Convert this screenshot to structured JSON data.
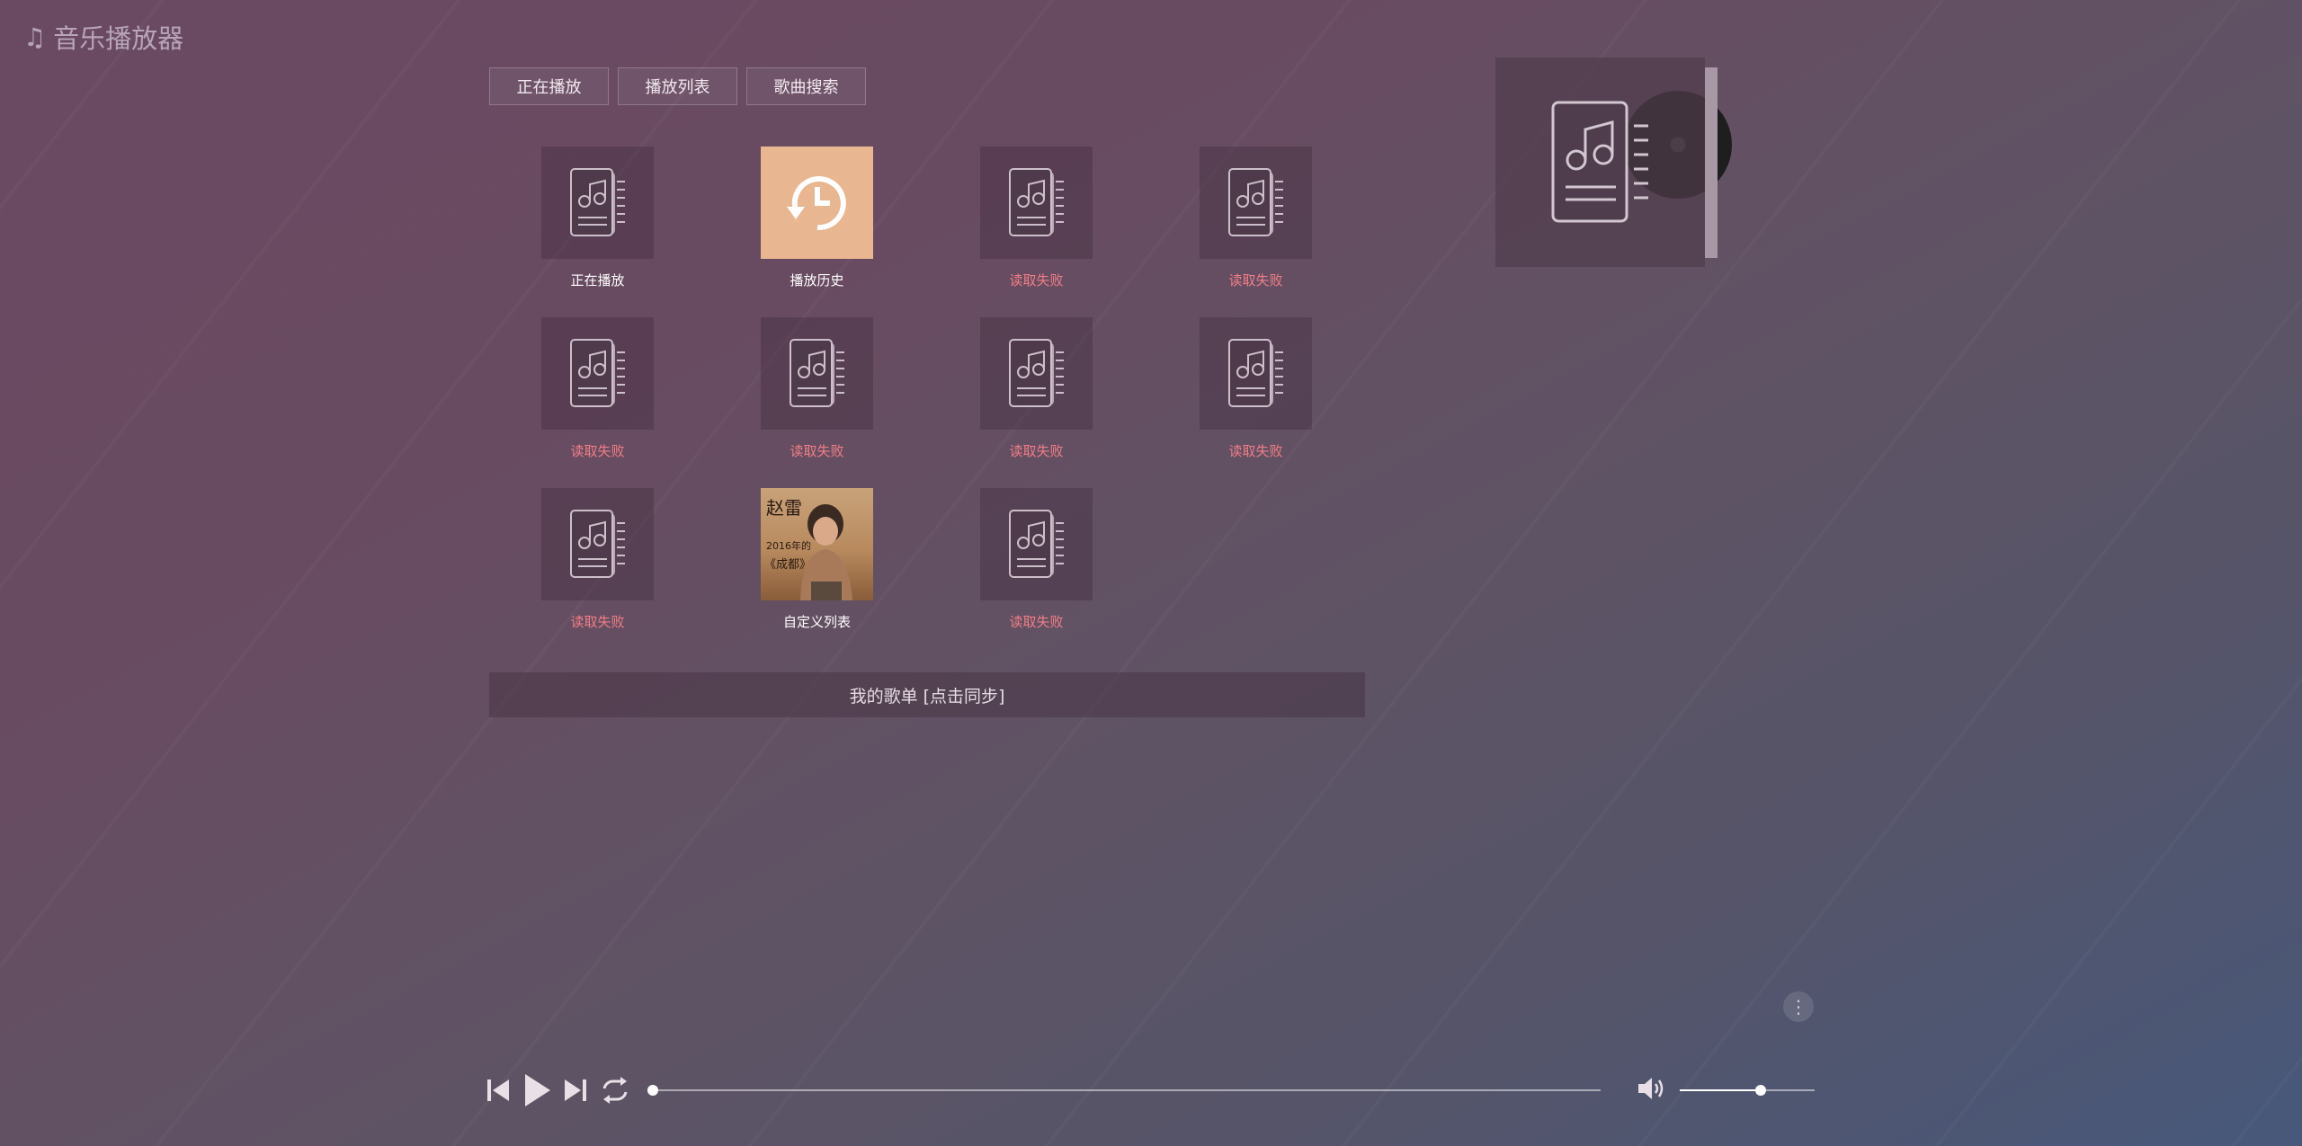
{
  "app": {
    "title": "音乐播放器",
    "title_icon": "music-note-icon"
  },
  "tabs": [
    {
      "label": "正在播放"
    },
    {
      "label": "播放列表"
    },
    {
      "label": "歌曲搜索"
    }
  ],
  "playlists": [
    {
      "label": "正在播放",
      "status": "ok",
      "cover": "music-list-icon"
    },
    {
      "label": "播放历史",
      "status": "ok",
      "cover": "history-icon"
    },
    {
      "label": "读取失败",
      "status": "fail",
      "cover": "music-list-icon"
    },
    {
      "label": "读取失败",
      "status": "fail",
      "cover": "music-list-icon"
    },
    {
      "label": "读取失败",
      "status": "fail",
      "cover": "music-list-icon"
    },
    {
      "label": "读取失败",
      "status": "fail",
      "cover": "music-list-icon"
    },
    {
      "label": "读取失败",
      "status": "fail",
      "cover": "music-list-icon"
    },
    {
      "label": "读取失败",
      "status": "fail",
      "cover": "music-list-icon"
    },
    {
      "label": "读取失败",
      "status": "fail",
      "cover": "music-list-icon"
    },
    {
      "label": "自定义列表",
      "status": "ok",
      "cover": "album-photo",
      "photo_text": [
        "赵雷",
        "2016年的",
        "《成都》"
      ]
    },
    {
      "label": "读取失败",
      "status": "fail",
      "cover": "music-list-icon"
    }
  ],
  "sync_bar": {
    "label": "我的歌单 [点击同步]"
  },
  "player": {
    "progress": 0.0,
    "volume": 0.6
  },
  "colors": {
    "fail_text": "#f07e86",
    "ok_text": "#ffffff",
    "history_cover": "#e8b690"
  }
}
